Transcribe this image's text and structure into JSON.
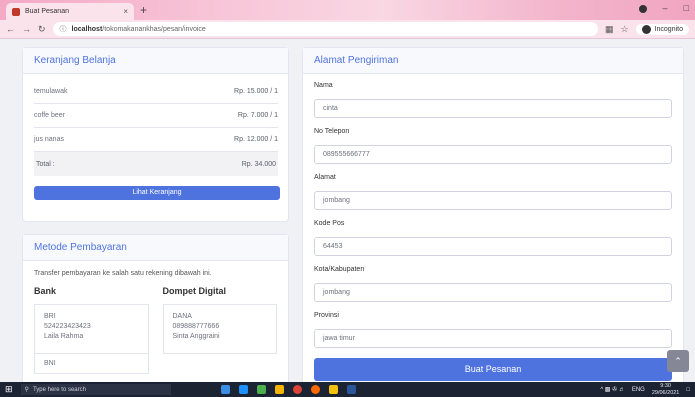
{
  "browser": {
    "tab_title": "Buat Pesanan",
    "tab_close": "×",
    "new_tab": "+",
    "url_host": "localhost",
    "url_path": "/tokomakanankhas/pesan/invoice",
    "incognito_label": "Incognito",
    "min_label": "–",
    "max_label": "□"
  },
  "cart": {
    "title": "Keranjang Belanja",
    "items": [
      {
        "name": "temulawak",
        "price": "Rp. 15.000 / 1"
      },
      {
        "name": "coffe beer",
        "price": "Rp. 7.000 / 1"
      },
      {
        "name": "jus nanas",
        "price": "Rp. 12.000 / 1"
      }
    ],
    "total_label": "Total :",
    "total_value": "Rp. 34.000",
    "button_label": "Lihat Keranjang"
  },
  "payment": {
    "title": "Metode Pembayaran",
    "intro": "Transfer pembayaran ke salah satu rekening dibawah ini.",
    "bank_heading": "Bank",
    "wallet_heading": "Dompet Digital",
    "bank": [
      {
        "name": "BRI",
        "number": "524223423423",
        "holder": "Laila Rahma"
      },
      {
        "name": "BNI"
      }
    ],
    "wallet": [
      {
        "name": "DANA",
        "number": "089888777666",
        "holder": "Sinta Anggraini"
      }
    ]
  },
  "shipping": {
    "title": "Alamat Pengiriman",
    "fields": [
      {
        "label": "Nama",
        "value": "cinta"
      },
      {
        "label": "No Telepon",
        "value": "089555666777"
      },
      {
        "label": "Alamat",
        "value": "jombang"
      },
      {
        "label": "Kode Pos",
        "value": "64453"
      },
      {
        "label": "Kota/Kabupaten",
        "value": "jombang"
      },
      {
        "label": "Provinsi",
        "value": "jawa timur"
      }
    ],
    "submit_label": "Buat Pesanan"
  },
  "taskbar": {
    "search_placeholder": "Type here to search",
    "lang": "ENG",
    "time": "9:30",
    "date": "29/06/2021"
  }
}
